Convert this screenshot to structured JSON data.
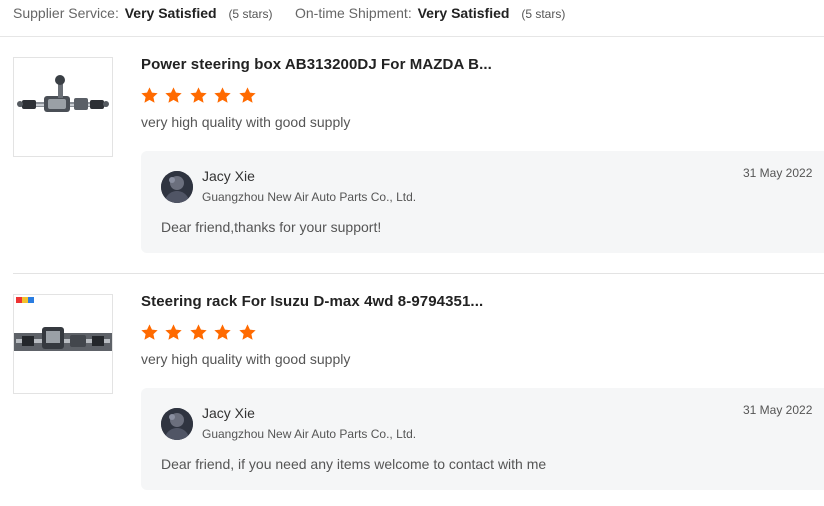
{
  "summary": {
    "supplier_service": {
      "label": "Supplier Service:",
      "value": "Very Satisfied",
      "note": "(5 stars)"
    },
    "shipment": {
      "label": "On-time Shipment:",
      "value": "Very Satisfied",
      "note": "(5 stars)"
    }
  },
  "reviews": [
    {
      "title": "Power steering box AB313200DJ For MAZDA B...",
      "rating": 5,
      "comment": "very high quality with good supply",
      "reply": {
        "name": "Jacy Xie",
        "company": "Guangzhou New Air Auto Parts Co., Ltd.",
        "date": "31 May 2022",
        "text": "Dear friend,thanks for your support!"
      }
    },
    {
      "title": "Steering rack For Isuzu D-max 4wd 8-9794351...",
      "rating": 5,
      "comment": "very high quality with good supply",
      "reply": {
        "name": "Jacy Xie",
        "company": "Guangzhou New Air Auto Parts Co., Ltd.",
        "date": "31 May 2022",
        "text": "Dear friend, if you need any items welcome to contact with me"
      }
    }
  ],
  "colors": {
    "star": "#ff6a00",
    "reply_bg": "#f5f6f7"
  },
  "icons": {
    "star": "star-icon",
    "avatar": "user-avatar-image",
    "product": "steering-rack-image"
  }
}
